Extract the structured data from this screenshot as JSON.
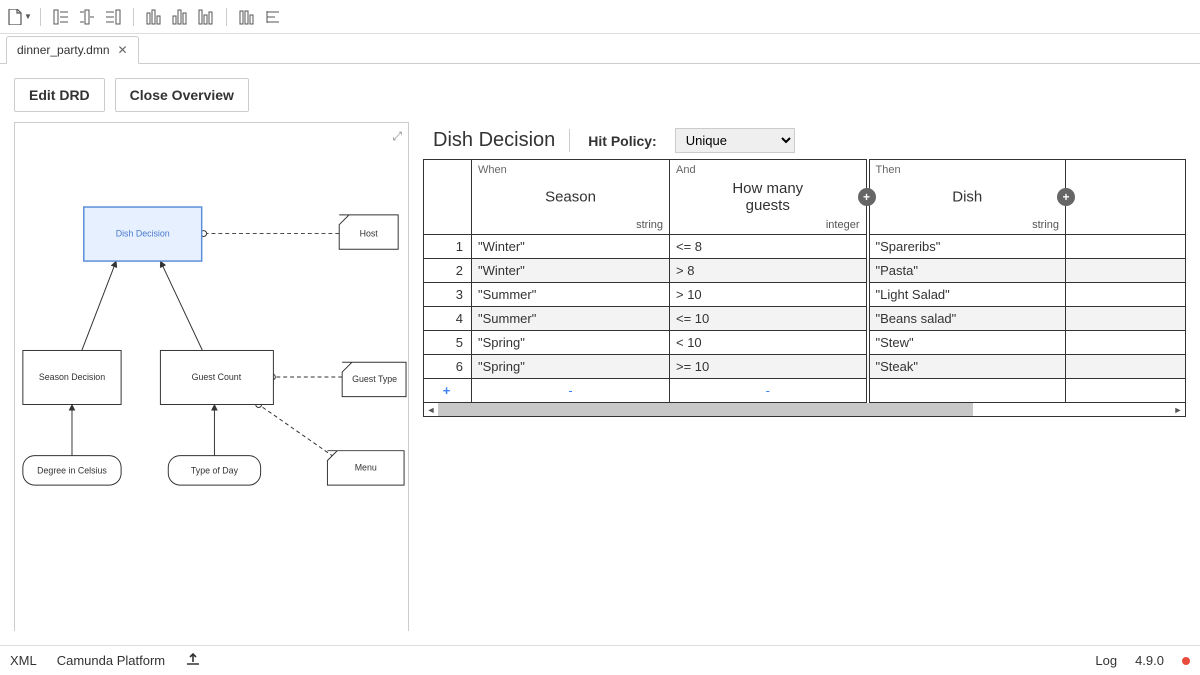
{
  "toolbar": {
    "file_icon": "file-icon",
    "icons": [
      "decision-table-icon",
      "decision-table-b-icon",
      "decision-table-c-icon",
      "chart-a-icon",
      "chart-b-icon",
      "chart-c-icon",
      "chart-d-icon",
      "align-icon"
    ]
  },
  "tab": {
    "label": "dinner_party.dmn"
  },
  "buttons": {
    "edit_drd": "Edit DRD",
    "close_overview": "Close Overview"
  },
  "drd": {
    "nodes": {
      "dish_decision": "Dish Decision",
      "host": "Host",
      "season_decision": "Season Decision",
      "guest_count": "Guest Count",
      "guest_type": "Guest Type",
      "degree": "Degree in Celsius",
      "type_of_day": "Type of Day",
      "menu": "Menu"
    }
  },
  "decision_table": {
    "title": "Dish Decision",
    "hit_policy_label": "Hit Policy:",
    "hit_policy_value": "Unique",
    "columns": {
      "input1": {
        "section": "When",
        "name": "Season",
        "type": "string"
      },
      "input2": {
        "section": "And",
        "name": "How many guests",
        "type": "integer"
      },
      "output1": {
        "section": "Then",
        "name": "Dish",
        "type": "string"
      }
    },
    "rows": [
      {
        "idx": "1",
        "c1": "\"Winter\"",
        "c2": "<= 8",
        "c3": "\"Spareribs\""
      },
      {
        "idx": "2",
        "c1": "\"Winter\"",
        "c2": "> 8",
        "c3": "\"Pasta\""
      },
      {
        "idx": "3",
        "c1": "\"Summer\"",
        "c2": "> 10",
        "c3": "\"Light Salad\""
      },
      {
        "idx": "4",
        "c1": "\"Summer\"",
        "c2": "<= 10",
        "c3": "\"Beans salad\""
      },
      {
        "idx": "5",
        "c1": "\"Spring\"",
        "c2": "< 10",
        "c3": "\"Stew\""
      },
      {
        "idx": "6",
        "c1": "\"Spring\"",
        "c2": ">= 10",
        "c3": "\"Steak\""
      }
    ],
    "add_placeholder": "-"
  },
  "status": {
    "xml": "XML",
    "platform": "Camunda Platform",
    "log": "Log",
    "version": "4.9.0"
  }
}
